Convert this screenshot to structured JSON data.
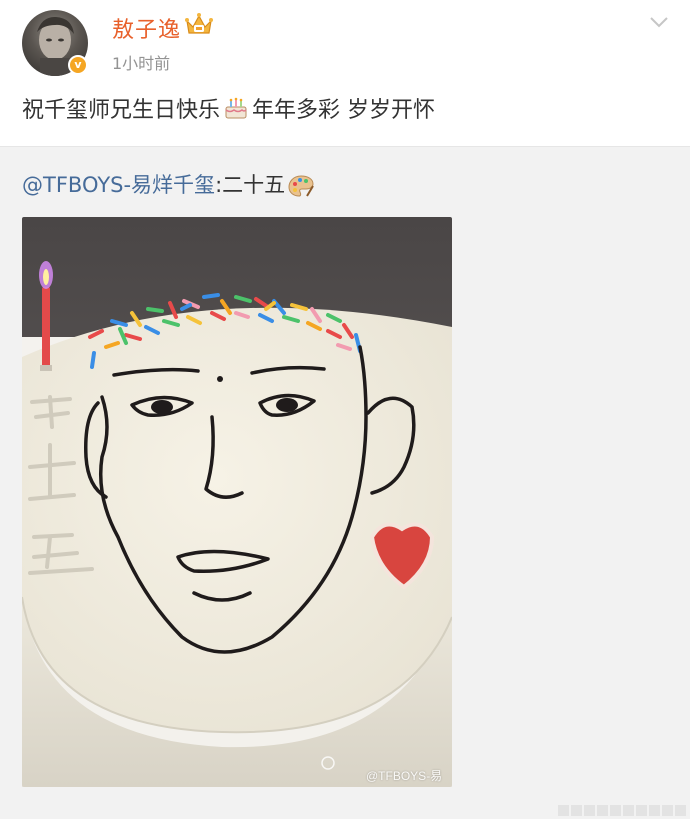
{
  "post": {
    "author": {
      "name": "敖子逸",
      "avatar_icon": "avatar",
      "badge_icon": "crown-icon",
      "verified_mark": "v",
      "verified_color": "#f5a623",
      "name_color": "#e8612c"
    },
    "timestamp": "1小时前",
    "menu_icon": "chevron-down-icon",
    "text_part1": "祝千玺师兄生日快乐",
    "emoji_icon": "cake-emoji-icon",
    "text_part2": "年年多彩 岁岁开怀"
  },
  "repost": {
    "mention": "@TFBOYS-易烊千玺",
    "separator": ":",
    "content": "二十五",
    "emoji_icon": "palette-icon",
    "mention_color": "#466b99",
    "image": {
      "description_icon": "cake-photo",
      "cake_writing": "二十五",
      "watermark": "@TFBOYS-易"
    }
  }
}
